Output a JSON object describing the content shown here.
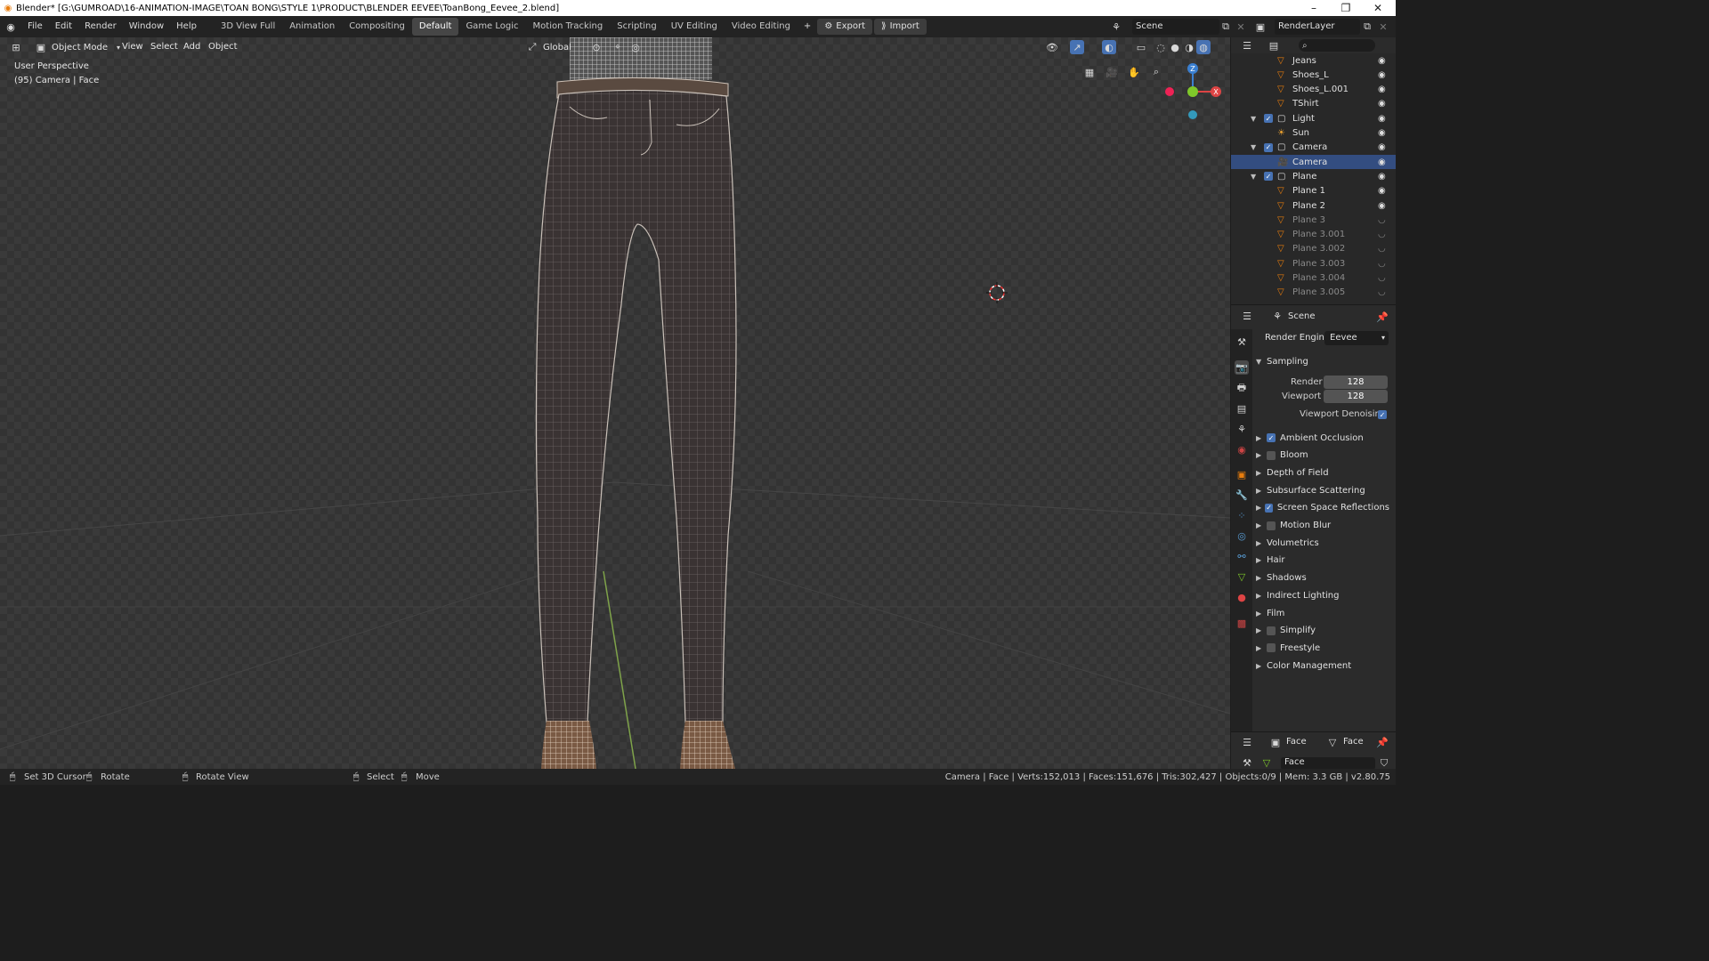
{
  "window": {
    "title": "Blender* [G:\\GUMROAD\\16-ANIMATION-IMAGE\\TOAN BONG\\STYLE 1\\PRODUCT\\BLENDER EEVEE\\ToanBong_Eevee_2.blend]",
    "controls": [
      "–",
      "❐",
      "✕"
    ]
  },
  "menu": [
    "File",
    "Edit",
    "Render",
    "Window",
    "Help"
  ],
  "workspaces": [
    "3D View Full",
    "Animation",
    "Compositing",
    "Default",
    "Game Logic",
    "Motion Tracking",
    "Scripting",
    "UV Editing",
    "Video Editing"
  ],
  "active_workspace": "Default",
  "add_workspace": "+",
  "export_label": "Export",
  "import_label": "Import",
  "scene": "Scene",
  "render_layer": "RenderLayer",
  "viewport": {
    "mode": "Object Mode",
    "menus": [
      "View",
      "Select",
      "Add",
      "Object"
    ],
    "orientation": "Global",
    "perspective": "User Perspective",
    "info": "(95) Camera | Face"
  },
  "gizmo": {
    "z": "Z",
    "x": "X"
  },
  "outliner": [
    {
      "name": "Jeans",
      "indent": 2,
      "icon": "mesh"
    },
    {
      "name": "Shoes_L",
      "indent": 2,
      "icon": "mesh"
    },
    {
      "name": "Shoes_L.001",
      "indent": 2,
      "icon": "mesh"
    },
    {
      "name": "TShirt",
      "indent": 2,
      "icon": "mesh"
    },
    {
      "name": "Light",
      "indent": 1,
      "icon": "collection"
    },
    {
      "name": "Sun",
      "indent": 2,
      "icon": "light"
    },
    {
      "name": "Camera",
      "indent": 1,
      "icon": "collection"
    },
    {
      "name": "Camera",
      "indent": 2,
      "icon": "camera",
      "selected": true
    },
    {
      "name": "Plane",
      "indent": 1,
      "icon": "collection"
    },
    {
      "name": "Plane 1",
      "indent": 2,
      "icon": "mesh"
    },
    {
      "name": "Plane 2",
      "indent": 2,
      "icon": "mesh"
    },
    {
      "name": "Plane 3",
      "indent": 2,
      "icon": "mesh",
      "dim": true
    },
    {
      "name": "Plane 3.001",
      "indent": 2,
      "icon": "mesh",
      "dim": true
    },
    {
      "name": "Plane 3.002",
      "indent": 2,
      "icon": "mesh",
      "dim": true
    },
    {
      "name": "Plane 3.003",
      "indent": 2,
      "icon": "mesh",
      "dim": true
    },
    {
      "name": "Plane 3.004",
      "indent": 2,
      "icon": "mesh",
      "dim": true
    },
    {
      "name": "Plane 3.005",
      "indent": 2,
      "icon": "mesh",
      "dim": true
    }
  ],
  "properties": {
    "context": "Scene",
    "render_engine_label": "Render Engine",
    "render_engine": "Eevee",
    "sampling": "Sampling",
    "render_label": "Render",
    "render_value": "128",
    "viewport_label": "Viewport",
    "viewport_value": "128",
    "viewport_denoising": "Viewport Denoising",
    "sections": [
      {
        "label": "Ambient Occlusion",
        "check": true
      },
      {
        "label": "Bloom",
        "check": false
      },
      {
        "label": "Depth of Field"
      },
      {
        "label": "Subsurface Scattering"
      },
      {
        "label": "Screen Space Reflections",
        "check": true
      },
      {
        "label": "Motion Blur",
        "check": false
      },
      {
        "label": "Volumetrics"
      },
      {
        "label": "Hair"
      },
      {
        "label": "Shadows"
      },
      {
        "label": "Indirect Lighting"
      },
      {
        "label": "Film"
      },
      {
        "label": "Simplify",
        "check": false
      },
      {
        "label": "Freestyle",
        "check": false
      },
      {
        "label": "Color Management"
      }
    ]
  },
  "data_panel": {
    "object": "Face",
    "mesh": "Face",
    "field": "Face"
  },
  "status": {
    "set_cursor": "Set 3D Cursor",
    "rotate": "Rotate",
    "rotate_view": "Rotate View",
    "select": "Select",
    "move": "Move",
    "stats": "Camera | Face | Verts:152,013 | Faces:151,676 | Tris:302,427 | Objects:0/9 | Mem: 3.3 GB | v2.80.75"
  },
  "colors": {
    "accent": "#4772b3",
    "selected_row": "#334d80",
    "orange": "#e87d0d"
  }
}
